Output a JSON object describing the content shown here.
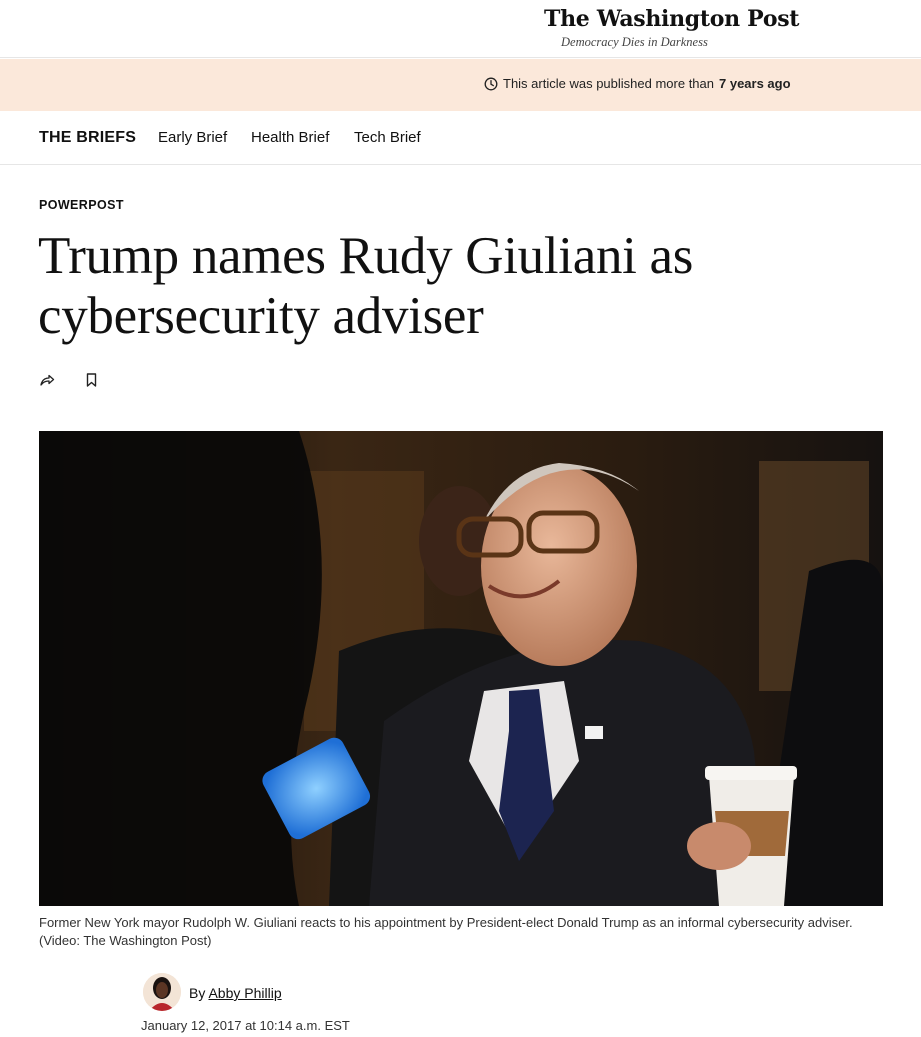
{
  "masthead": {
    "logo": "The Washington Post",
    "tagline": "Democracy Dies in Darkness"
  },
  "age_banner": {
    "prefix": "This article was published more than",
    "age": "7 years ago",
    "icon": "clock-icon"
  },
  "section_nav": {
    "title": "THE BRIEFS",
    "links": [
      "Early Brief",
      "Health Brief",
      "Tech Brief"
    ]
  },
  "article": {
    "kicker": "POWERPOST",
    "headline_line1": "Trump names Rudy Giuliani as",
    "headline_line2": "cybersecurity adviser",
    "tools": {
      "share_icon": "share-icon",
      "bookmark_icon": "bookmark-icon"
    },
    "caption_line1": "Former New York mayor Rudolph W. Giuliani reacts to his appointment by President-elect Donald Trump as an informal cybersecurity adviser.",
    "caption_line2": "(Video: The Washington Post)",
    "byline_prefix": "By",
    "author": "Abby Phillip",
    "date": "January 12, 2017 at 10:14 a.m. EST"
  },
  "colors": {
    "banner_bg": "#fbe8da",
    "text": "#111111",
    "divider": "#e6e6e6"
  }
}
